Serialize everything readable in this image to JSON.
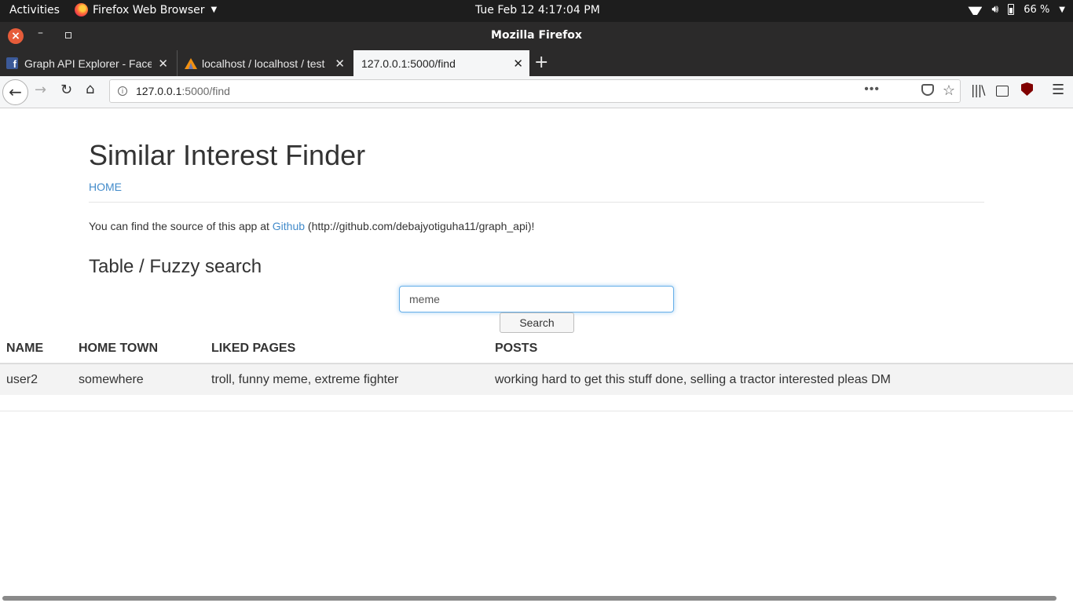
{
  "system_bar": {
    "activities": "Activities",
    "app_menu": "Firefox Web Browser",
    "clock": "Tue Feb 12   4:17:04 PM",
    "battery": "66 %"
  },
  "window": {
    "title": "Mozilla Firefox"
  },
  "tabs": [
    {
      "title": "Graph API Explorer - Facebook",
      "icon": "facebook-icon",
      "active": false
    },
    {
      "title": "localhost / localhost / test",
      "icon": "phpmyadmin-icon",
      "active": false
    },
    {
      "title": "127.0.0.1:5000/find",
      "icon": "",
      "active": true
    }
  ],
  "navbar": {
    "url_host": "127.0.0.1",
    "url_path": ":5000/find"
  },
  "page": {
    "heading": "Similar Interest Finder",
    "home_link": "HOME",
    "source_prefix": "You can find the source of this app at ",
    "source_link": "Github",
    "source_suffix": " (http://github.com/debajyotiguha11/graph_api)!",
    "subheading": "Table / Fuzzy search",
    "search_value": "meme",
    "search_button": "Search",
    "table": {
      "headers": [
        "NAME",
        "HOME TOWN",
        "LIKED PAGES",
        "POSTS"
      ],
      "rows": [
        [
          "user2",
          "somewhere",
          "troll, funny meme, extreme fighter",
          "working hard to get this stuff done, selling a tractor interested pleas DM"
        ]
      ]
    }
  },
  "colors": {
    "link": "#428bca",
    "topbar": "#1d1d1d",
    "tabstrip": "#2b2a2a",
    "close_button": "#e65c3a"
  }
}
